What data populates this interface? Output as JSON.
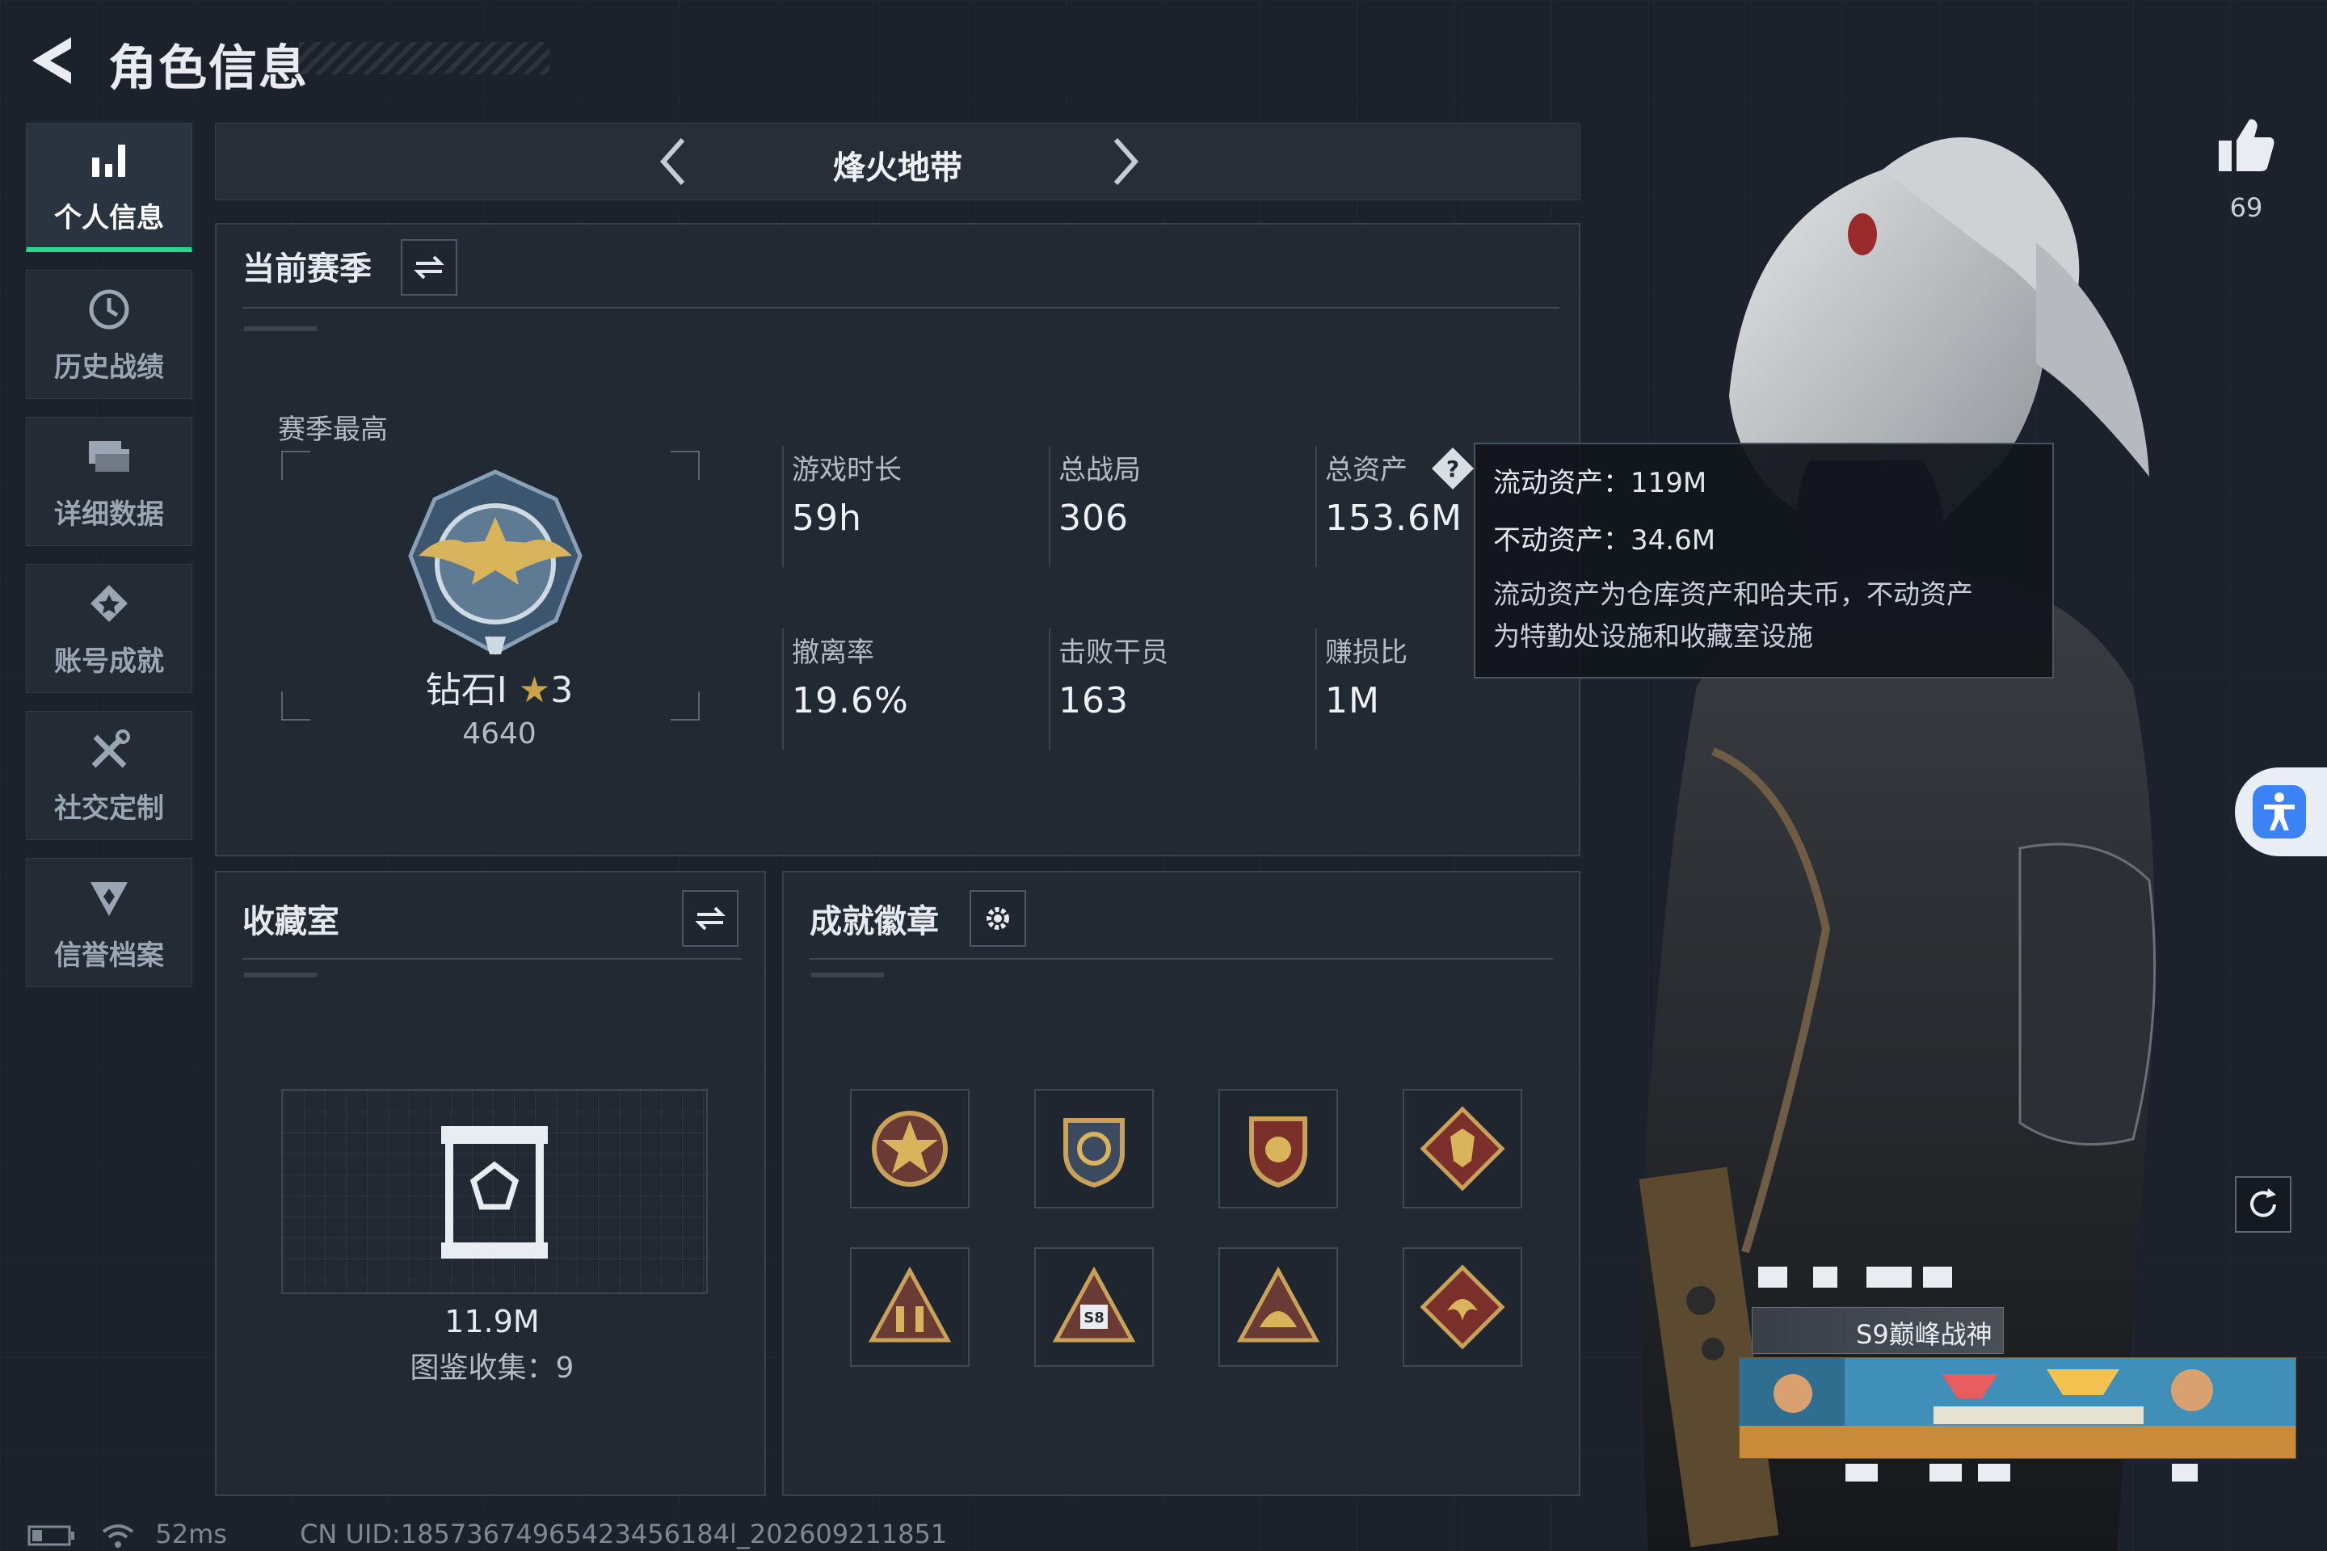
{
  "header": {
    "title": "角色信息"
  },
  "sidebar": {
    "items": [
      {
        "label": "个人信息",
        "icon": "bar-chart-icon",
        "active": true
      },
      {
        "label": "历史战绩",
        "icon": "clock-icon",
        "active": false
      },
      {
        "label": "详细数据",
        "icon": "folder-icon",
        "active": false
      },
      {
        "label": "账号成就",
        "icon": "medal-icon",
        "active": false
      },
      {
        "label": "社交定制",
        "icon": "tools-icon",
        "active": false
      },
      {
        "label": "信誉档案",
        "icon": "shield-icon",
        "active": false
      }
    ]
  },
  "mode": {
    "name": "烽火地带"
  },
  "season": {
    "title": "当前赛季",
    "best_label": "赛季最高",
    "rank_name": "钻石Ⅰ",
    "rank_stars": "3",
    "rank_score": "4640",
    "stats": [
      {
        "label": "游戏时长",
        "value": "59h"
      },
      {
        "label": "总战局",
        "value": "306"
      },
      {
        "label": "总资产",
        "value": "153.6M"
      },
      {
        "label": "撤离率",
        "value": "19.6%"
      },
      {
        "label": "击败干员",
        "value": "163"
      },
      {
        "label": "赚损比",
        "value": "1M"
      }
    ]
  },
  "tooltip": {
    "liquid": "流动资产：119M",
    "fixed": "不动资产：34.6M",
    "note_line1": "流动资产为仓库资产和哈夫币，不动资产",
    "note_line2": "为特勤处设施和收藏室设施"
  },
  "collection": {
    "title": "收藏室",
    "value": "11.9M",
    "catalog": "图鉴收集：9"
  },
  "badges": {
    "title": "成就徽章",
    "items": [
      "star-shield-badge",
      "wing-shield-badge",
      "eagle-shield-badge",
      "wolf-diamond-badge",
      "soldiers-triangle-badge",
      "s8-triangle-badge",
      "helmet-triangle-badge",
      "dragon-diamond-badge"
    ]
  },
  "profile": {
    "likes": "69",
    "title_plate": "S9巅峰战神"
  },
  "footer": {
    "ping": "52ms",
    "uid": "CN UID:18573674965423456184l_202609211851"
  },
  "colors": {
    "accent": "#2ed48a",
    "background": "#1b222b",
    "panel": "#222a34",
    "access_blue": "#3b82f6"
  }
}
